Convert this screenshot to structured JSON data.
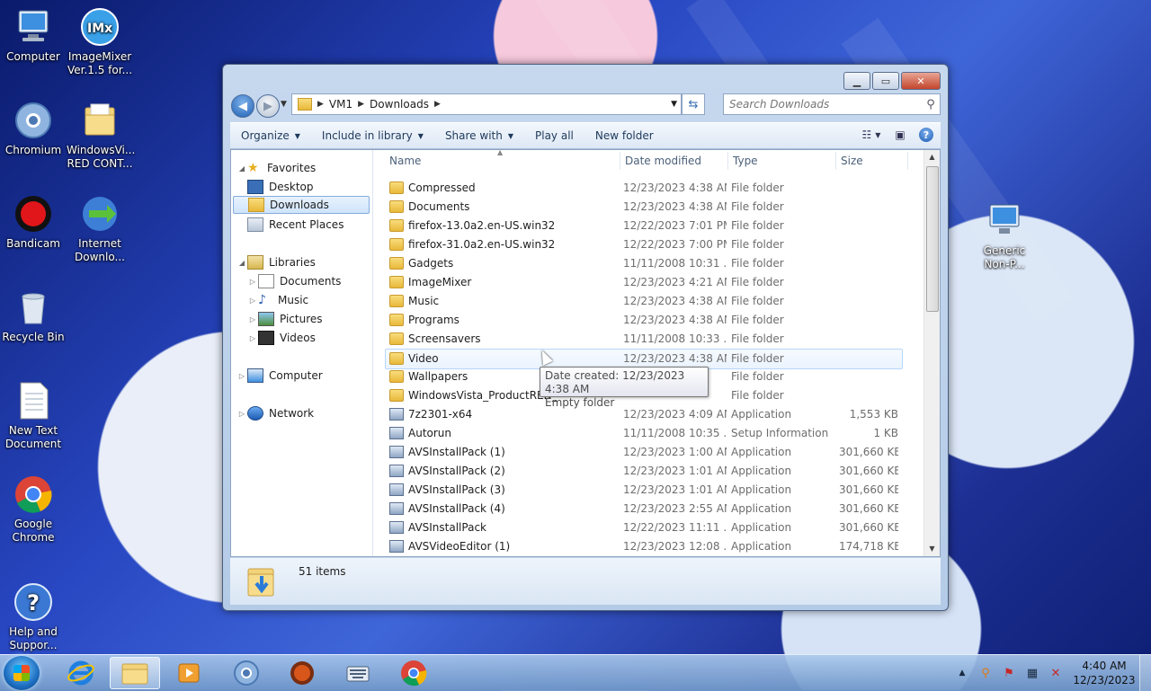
{
  "desktop": {
    "icons": [
      {
        "label": "Computer",
        "icon": "computer-icon"
      },
      {
        "label": "ImageMixer Ver.1.5 for...",
        "icon": "imagemixer-icon"
      },
      {
        "label": "Chromium",
        "icon": "chromium-icon"
      },
      {
        "label": "WindowsVi... RED CONT...",
        "icon": "folder-icon"
      },
      {
        "label": "Bandicam",
        "icon": "bandicam-icon"
      },
      {
        "label": "Internet Downlo...",
        "icon": "idm-icon"
      },
      {
        "label": "Recycle Bin",
        "icon": "recycle-bin-icon"
      },
      {
        "label": "New Text Document",
        "icon": "text-document-icon"
      },
      {
        "label": "Google Chrome",
        "icon": "chrome-icon"
      },
      {
        "label": "Help and Suppor...",
        "icon": "help-icon"
      },
      {
        "label": "Generic Non-P...",
        "icon": "monitor-icon"
      }
    ]
  },
  "window": {
    "address": {
      "root": "VM1",
      "current": "Downloads"
    },
    "search_placeholder": "Search Downloads",
    "toolbar": {
      "organize": "Organize",
      "include_in_library": "Include in library",
      "share_with": "Share with",
      "play_all": "Play all",
      "new_folder": "New folder"
    },
    "nav": {
      "favorites": "Favorites",
      "desktop": "Desktop",
      "downloads": "Downloads",
      "recent_places": "Recent Places",
      "libraries": "Libraries",
      "documents": "Documents",
      "music": "Music",
      "pictures": "Pictures",
      "videos": "Videos",
      "computer": "Computer",
      "network": "Network"
    },
    "columns": {
      "name": "Name",
      "date": "Date modified",
      "type": "Type",
      "size": "Size"
    },
    "files": [
      {
        "name": "Compressed",
        "date": "12/23/2023 4:38 AM",
        "type": "File folder",
        "size": "",
        "kind": "folder"
      },
      {
        "name": "Documents",
        "date": "12/23/2023 4:38 AM",
        "type": "File folder",
        "size": "",
        "kind": "folder"
      },
      {
        "name": "firefox-13.0a2.en-US.win32",
        "date": "12/22/2023 7:01 PM",
        "type": "File folder",
        "size": "",
        "kind": "folder"
      },
      {
        "name": "firefox-31.0a2.en-US.win32",
        "date": "12/22/2023 7:00 PM",
        "type": "File folder",
        "size": "",
        "kind": "folder"
      },
      {
        "name": "Gadgets",
        "date": "11/11/2008 10:31 ...",
        "type": "File folder",
        "size": "",
        "kind": "folder"
      },
      {
        "name": "ImageMixer",
        "date": "12/23/2023 4:21 AM",
        "type": "File folder",
        "size": "",
        "kind": "folder"
      },
      {
        "name": "Music",
        "date": "12/23/2023 4:38 AM",
        "type": "File folder",
        "size": "",
        "kind": "folder"
      },
      {
        "name": "Programs",
        "date": "12/23/2023 4:38 AM",
        "type": "File folder",
        "size": "",
        "kind": "folder"
      },
      {
        "name": "Screensavers",
        "date": "11/11/2008 10:33 ...",
        "type": "File folder",
        "size": "",
        "kind": "folder"
      },
      {
        "name": "Video",
        "date": "12/23/2023 4:38 AM",
        "type": "File folder",
        "size": "",
        "kind": "folder"
      },
      {
        "name": "Wallpapers",
        "date": "",
        "type": "File folder",
        "size": "",
        "kind": "folder"
      },
      {
        "name": "WindowsVista_ProductRED_",
        "date": "",
        "type": "File folder",
        "size": "",
        "kind": "folder"
      },
      {
        "name": "7z2301-x64",
        "date": "12/23/2023 4:09 AM",
        "type": "Application",
        "size": "1,553 KB",
        "kind": "app"
      },
      {
        "name": "Autorun",
        "date": "11/11/2008 10:35 ...",
        "type": "Setup Information",
        "size": "1 KB",
        "kind": "app"
      },
      {
        "name": "AVSInstallPack (1)",
        "date": "12/23/2023 1:00 AM",
        "type": "Application",
        "size": "301,660 KB",
        "kind": "app"
      },
      {
        "name": "AVSInstallPack (2)",
        "date": "12/23/2023 1:01 AM",
        "type": "Application",
        "size": "301,660 KB",
        "kind": "app"
      },
      {
        "name": "AVSInstallPack (3)",
        "date": "12/23/2023 1:01 AM",
        "type": "Application",
        "size": "301,660 KB",
        "kind": "app"
      },
      {
        "name": "AVSInstallPack (4)",
        "date": "12/23/2023 2:55 AM",
        "type": "Application",
        "size": "301,660 KB",
        "kind": "app"
      },
      {
        "name": "AVSInstallPack",
        "date": "12/22/2023 11:11 ...",
        "type": "Application",
        "size": "301,660 KB",
        "kind": "app"
      },
      {
        "name": "AVSVideoEditor (1)",
        "date": "12/23/2023 12:08 ...",
        "type": "Application",
        "size": "174,718 KB",
        "kind": "app"
      }
    ],
    "tooltip": {
      "line1": "Date created: 12/23/2023 4:38 AM",
      "line2": "Empty folder"
    },
    "status": {
      "item_count": "51 items"
    }
  },
  "taskbar": {
    "clock_time": "4:40 AM",
    "clock_date": "12/23/2023"
  },
  "colors": {
    "selection": "#cfe4fb",
    "accent": "#1f5fb3"
  }
}
